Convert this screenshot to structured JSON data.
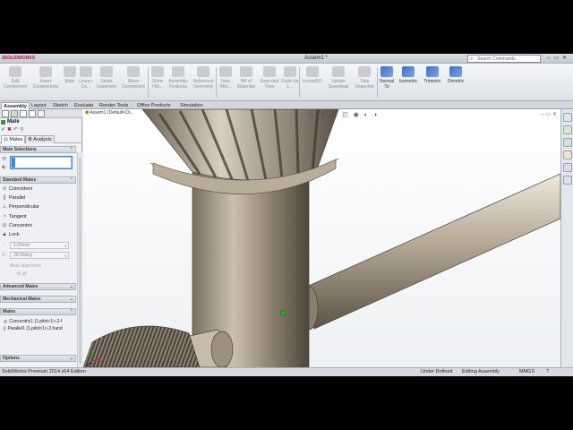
{
  "window": {
    "app_name": "SOLIDWORKS",
    "doc_title": "Assem1 *",
    "search_placeholder": "Search Commands",
    "controls": [
      "–",
      "▭",
      "✕"
    ]
  },
  "commands": [
    {
      "label": "Edit Component",
      "icon": "edit-component-icon",
      "enabled": false
    },
    {
      "label": "Insert Components",
      "icon": "insert-components-icon",
      "enabled": false
    },
    {
      "label": "Mate",
      "icon": "mate-icon",
      "enabled": false
    },
    {
      "label": "Linea r Co...",
      "icon": "linear-pattern-icon",
      "enabled": false
    },
    {
      "label": "Smart Fasteners",
      "icon": "smart-fasteners-icon",
      "enabled": false
    },
    {
      "label": "Move Component",
      "icon": "move-component-icon",
      "enabled": false
    },
    {
      "label": "Show Hid...",
      "icon": "show-hidden-icon",
      "enabled": false
    },
    {
      "label": "Assembly Features",
      "icon": "assembly-features-icon",
      "enabled": false
    },
    {
      "label": "Reference Geometry",
      "icon": "reference-geometry-icon",
      "enabled": false
    },
    {
      "label": "New Mot...",
      "icon": "new-motion-study-icon",
      "enabled": false
    },
    {
      "label": "Bill of Materials",
      "icon": "bill-of-materials-icon",
      "enabled": false
    },
    {
      "label": "Exploded View",
      "icon": "exploded-view-icon",
      "enabled": false
    },
    {
      "label": "Explo de L...",
      "icon": "explode-line-icon",
      "enabled": false
    },
    {
      "label": "InstantSD",
      "icon": "instant3d-icon",
      "enabled": false
    },
    {
      "label": "Update Speedpak",
      "icon": "update-speedpak-icon",
      "enabled": false
    },
    {
      "label": "Take Snapshot",
      "icon": "take-snapshot-icon",
      "enabled": false
    },
    {
      "label": "Normal To",
      "icon": "normal-to-icon",
      "enabled": true
    },
    {
      "label": "Isometric",
      "icon": "isometric-icon",
      "enabled": true
    },
    {
      "label": "Trimetric",
      "icon": "trimetric-icon",
      "enabled": true
    },
    {
      "label": "Dimetric",
      "icon": "dimetric-icon",
      "enabled": true
    }
  ],
  "tabs": [
    "Assembly",
    "Layout",
    "Sketch",
    "Evaluate",
    "Render Tools",
    "Office Products",
    "Simulation"
  ],
  "property_manager": {
    "title": "Mate",
    "mate_tabs": [
      "Mates",
      "Analysis"
    ],
    "groups": {
      "mate_selections": "Mate Selections",
      "standard_mates": "Standard Mates",
      "advanced_mates": "Advanced Mates",
      "mechanical_mates": "Mechanical Mates",
      "mates": "Mates",
      "options": "Options"
    },
    "standard_mates": [
      {
        "label": "Coincident",
        "icon": "coincident-icon"
      },
      {
        "label": "Parallel",
        "icon": "parallel-icon"
      },
      {
        "label": "Perpendicular",
        "icon": "perpendicular-icon"
      },
      {
        "label": "Tangent",
        "icon": "tangent-icon"
      },
      {
        "label": "Concentric",
        "icon": "concentric-icon"
      },
      {
        "label": "Lock",
        "icon": "lock-icon"
      }
    ],
    "distance_value": "1.00mm",
    "angle_value": "30.00deg",
    "mate_alignment": "Mate alignment:",
    "mates_list": [
      "Concentric1 (1.pilot<1>,2.f",
      "Parallel1 (1.pilot<1>,2.hand"
    ]
  },
  "viewport": {
    "tree_flyout": "Assem1 (Default<Di..."
  },
  "status": {
    "edition": "SolidWorks Premium 2014 x64 Edition",
    "definition": "Under Defined",
    "mode": "Editing Assembly",
    "units": "MMGS"
  }
}
